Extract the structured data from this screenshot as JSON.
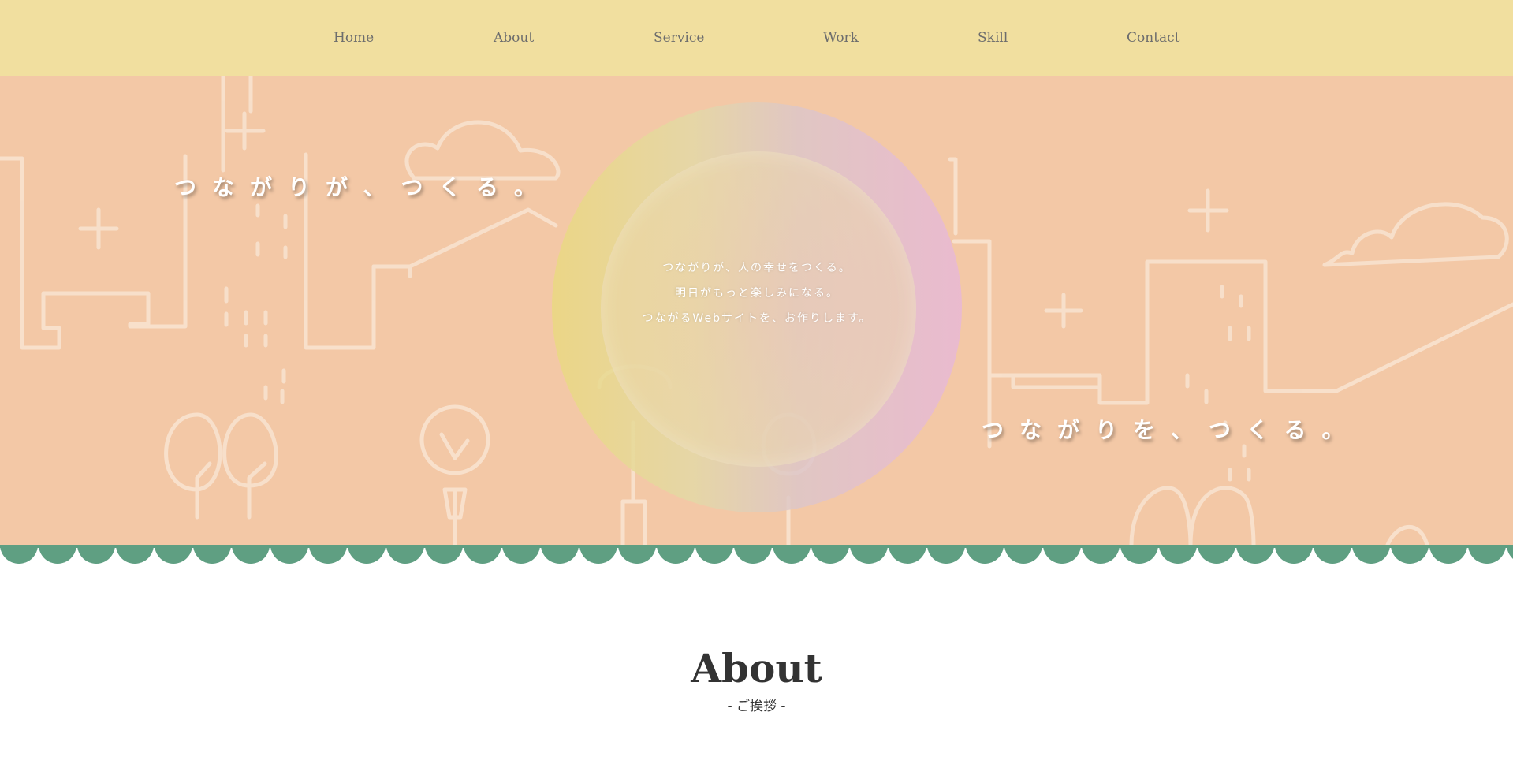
{
  "colors": {
    "header_bg": "#f1df9f",
    "hero_bg": "#f3c8a6",
    "scallop": "#5f9f82",
    "nav_text": "#6d6d6d",
    "heading_text": "#333333"
  },
  "nav": {
    "items": [
      {
        "label": "Home"
      },
      {
        "label": "About"
      },
      {
        "label": "Service"
      },
      {
        "label": "Work"
      },
      {
        "label": "Skill"
      },
      {
        "label": "Contact"
      }
    ]
  },
  "hero": {
    "tagline_left": "つながりが、つくる。",
    "tagline_right": "つながりを、つくる。",
    "message_lines": [
      "つながりが、人の幸せをつくる。",
      "明日がもっと楽しみになる。",
      "つながるWebサイトを、お作りします。"
    ]
  },
  "about": {
    "title": "About",
    "subtitle": "- ご挨拶 -"
  }
}
